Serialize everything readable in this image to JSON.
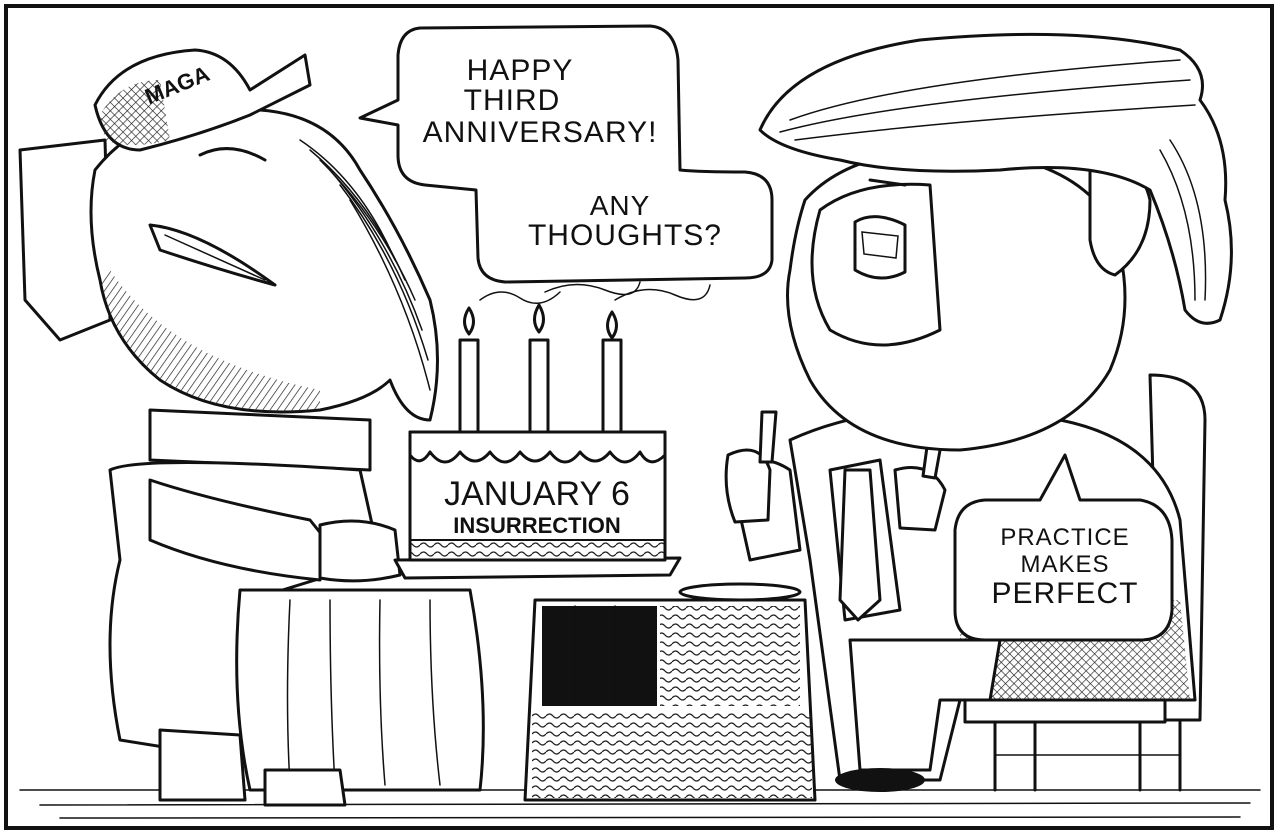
{
  "bubbles": {
    "elephant_line1": "HAPPY",
    "elephant_line2": "THIRD",
    "elephant_line3": "ANNIVERSARY!",
    "elephant_question_line1": "ANY",
    "elephant_question_line2": "THOUGHTS?",
    "trump_line1": "PRACTICE",
    "trump_line2": "MAKES",
    "trump_line3": "PERFECT"
  },
  "cap": {
    "text": "MAGA"
  },
  "cake": {
    "line1": "JANUARY 6",
    "line2": "INSURRECTION",
    "candles": 3
  }
}
